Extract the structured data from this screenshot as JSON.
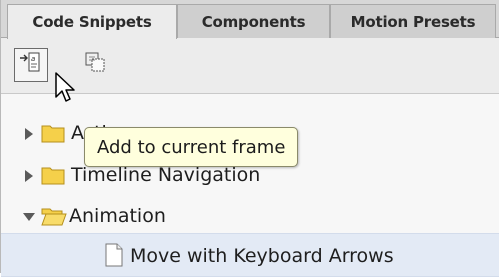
{
  "tabs": [
    {
      "label": "Code Snippets",
      "active": true
    },
    {
      "label": "Components",
      "active": false
    },
    {
      "label": "Motion Presets",
      "active": false
    }
  ],
  "toolbar": {
    "buttons": [
      {
        "icon": "add-to-frame-icon"
      },
      {
        "icon": "copy-to-clipboard-icon"
      }
    ]
  },
  "tree": {
    "items": [
      {
        "label": "Actions",
        "type": "folder",
        "expanded": false
      },
      {
        "label": "Timeline Navigation",
        "type": "folder",
        "expanded": false
      },
      {
        "label": "Animation",
        "type": "folder",
        "expanded": true
      },
      {
        "label": "Move with Keyboard Arrows",
        "type": "snippet",
        "selected": true
      }
    ]
  },
  "tooltip": {
    "text": "Add to current frame"
  },
  "colors": {
    "folder_fill": "#f5d04a",
    "selection": "#e3eaf5",
    "tooltip_bg": "#ffffdd"
  }
}
